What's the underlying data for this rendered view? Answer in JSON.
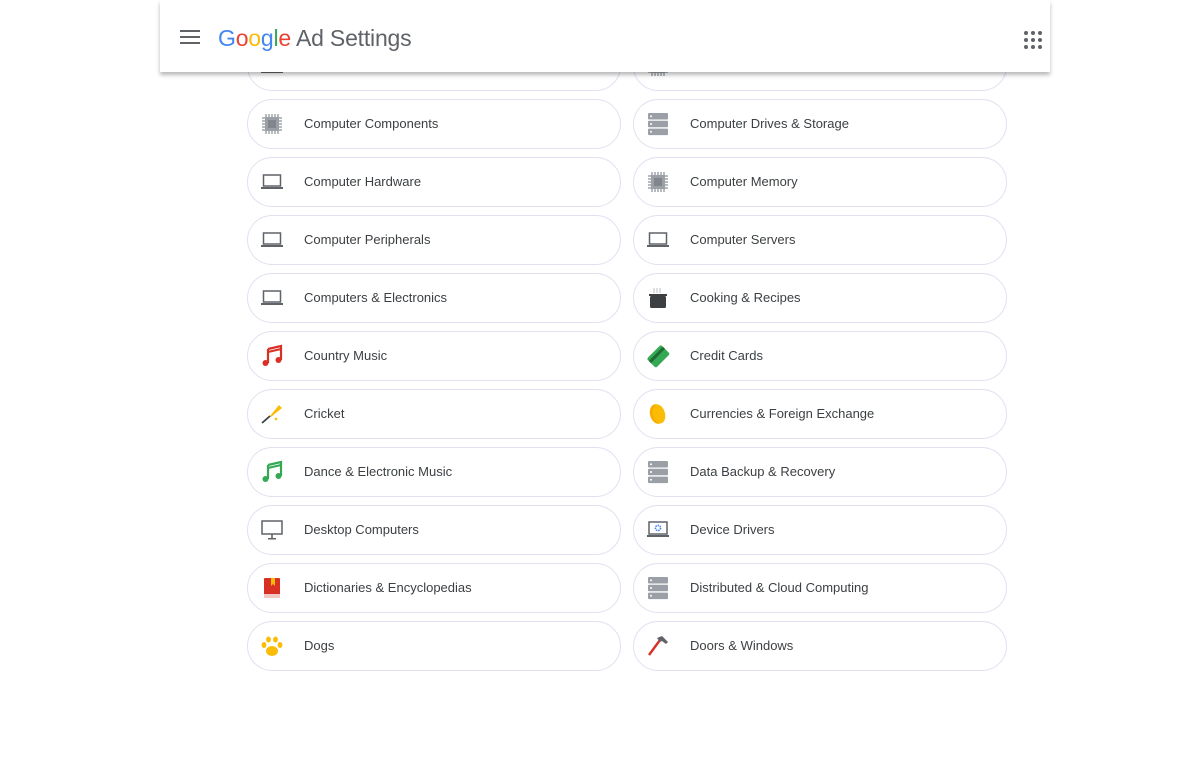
{
  "header": {
    "title_brand": "Google",
    "title_rest": "Ad Settings",
    "menu_icon": "hamburger-menu-icon",
    "apps_icon": "apps-grid-icon"
  },
  "topics": [
    {
      "label": "",
      "icon": "laptop-icon"
    },
    {
      "label": "",
      "icon": "chip-icon"
    },
    {
      "label": "Computer Components",
      "icon": "chip-icon"
    },
    {
      "label": "Computer Drives & Storage",
      "icon": "server-icon"
    },
    {
      "label": "Computer Hardware",
      "icon": "laptop-icon"
    },
    {
      "label": "Computer Memory",
      "icon": "chip-icon"
    },
    {
      "label": "Computer Peripherals",
      "icon": "laptop-icon"
    },
    {
      "label": "Computer Servers",
      "icon": "laptop-icon"
    },
    {
      "label": "Computers & Electronics",
      "icon": "laptop-icon"
    },
    {
      "label": "Cooking & Recipes",
      "icon": "cooking-pot-icon"
    },
    {
      "label": "Country Music",
      "icon": "music-note-icon",
      "color": "#d93025"
    },
    {
      "label": "Credit Cards",
      "icon": "credit-card-icon"
    },
    {
      "label": "Cricket",
      "icon": "cricket-bat-icon"
    },
    {
      "label": "Currencies & Foreign Exchange",
      "icon": "coin-icon"
    },
    {
      "label": "Dance & Electronic Music",
      "icon": "music-note-icon",
      "color": "#34a853"
    },
    {
      "label": "Data Backup & Recovery",
      "icon": "server-icon"
    },
    {
      "label": "Desktop Computers",
      "icon": "desktop-monitor-icon"
    },
    {
      "label": "Device Drivers",
      "icon": "laptop-gear-icon"
    },
    {
      "label": "Dictionaries & Encyclopedias",
      "icon": "book-icon"
    },
    {
      "label": "Distributed & Cloud Computing",
      "icon": "server-icon"
    },
    {
      "label": "Dogs",
      "icon": "paw-icon"
    },
    {
      "label": "Doors & Windows",
      "icon": "hammer-icon"
    }
  ]
}
